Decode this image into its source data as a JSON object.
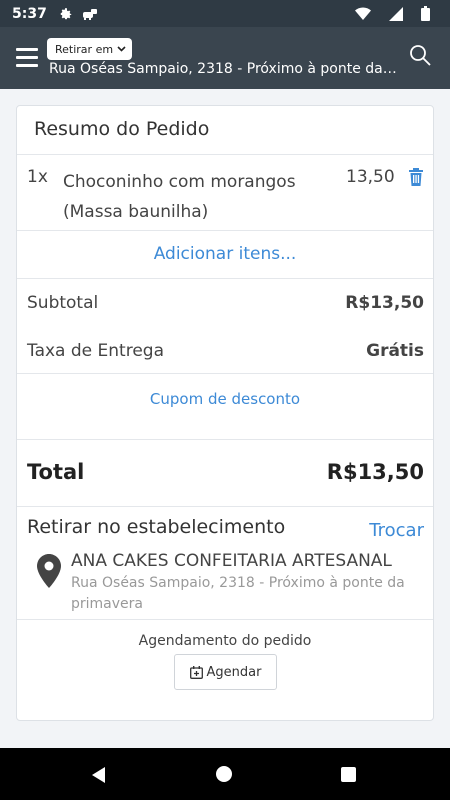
{
  "status_bar": {
    "time": "5:37",
    "icons": [
      "settings-icon",
      "dino-icon",
      "wifi-icon",
      "signal-icon",
      "battery-icon"
    ]
  },
  "app_bar": {
    "mode_label": "Retirar em",
    "address": "Rua Oséas Sampaio, 2318 - Próximo à ponte da p..."
  },
  "order_summary": {
    "title": "Resumo do Pedido",
    "items": [
      {
        "qty": "1x",
        "name_line1": "Choconinho com morangos",
        "name_line2": "(Massa baunilha)",
        "price": "13,50"
      }
    ],
    "add_items_label": "Adicionar itens...",
    "subtotal_label": "Subtotal",
    "subtotal_value": "R$13,50",
    "delivery_label": "Taxa de Entrega",
    "delivery_value": "Grátis",
    "coupon_label": "Cupom de desconto",
    "total_label": "Total",
    "total_value": "R$13,50"
  },
  "pickup": {
    "title": "Retirar no estabelecimento",
    "change_label": "Trocar",
    "store_name": "ANA CAKES CONFEITARIA ARTESANAL",
    "store_address": "Rua Oséas Sampaio, 2318 - Próximo à ponte da primavera"
  },
  "scheduling": {
    "title": "Agendamento do pedido",
    "button_label": "Agendar"
  },
  "colors": {
    "app_bar": "#3a454f",
    "status_bar": "#2f3a44",
    "accent_link": "#3d8ad6",
    "background": "#f2f4f7"
  }
}
